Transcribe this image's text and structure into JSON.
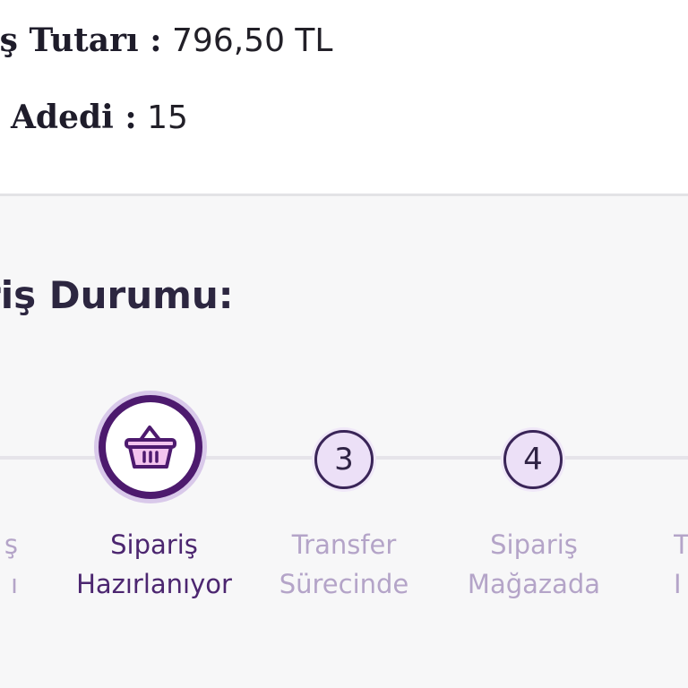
{
  "order_summary": {
    "total_label": "iş Tutarı :",
    "total_value": "796,50 TL",
    "count_label": "Adedi :",
    "count_value": "15"
  },
  "status": {
    "title": "riş Durumu:",
    "steps": [
      {
        "line1": "ş",
        "line2": "ı",
        "state": "completed"
      },
      {
        "icon": "basket-icon",
        "line1": "Sipariş",
        "line2": "Hazırlanıyor",
        "state": "active"
      },
      {
        "number": "3",
        "line1": "Transfer",
        "line2": "Sürecinde",
        "state": "pending"
      },
      {
        "number": "4",
        "line1": "Sipariş",
        "line2": "Mağazada",
        "state": "pending"
      },
      {
        "line1": "T",
        "line2": "I",
        "state": "pending"
      }
    ]
  },
  "colors": {
    "active_ring": "#4d1a6e",
    "active_text": "#4c2670",
    "pending_text": "#b4a4c8",
    "pending_fill": "#ece0f7",
    "track": "#e6e4ea"
  }
}
